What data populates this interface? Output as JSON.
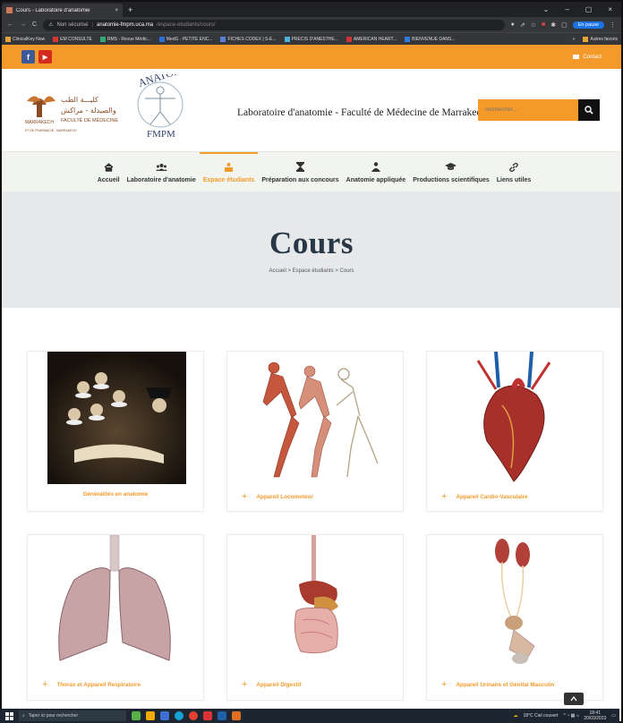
{
  "browser": {
    "tab_title": "Cours - Laboratoire d'anatomie",
    "tab_close": "×",
    "new_tab": "+",
    "window_controls": [
      "⌄",
      "–",
      "▢",
      "×"
    ],
    "security_label": "Non sécurisé",
    "url_domain": "anatomie-fmpm.uca.ma",
    "url_path": "/espace-etudiants/cours/",
    "profile_label": "En pause",
    "bookmarks": [
      "ClinicalKey Now",
      "EM CONSULTE",
      "RMS - Revue Médic...",
      "MedG - PETITE ENC...",
      "FICHES CODEX | S-E...",
      "PRECIS D'ANESTHE...",
      "AMERICAN HEART...",
      "BIENVENUE DANS..."
    ],
    "bookmarks_more": "»",
    "other_favorites": "Autres favoris"
  },
  "topbar": {
    "facebook_label": "f",
    "youtube_label": "▶",
    "contact_label": "Contact"
  },
  "header": {
    "logo_arabic_1": "كليـــة الطب",
    "logo_arabic_2": "والصيدلة - مراكش",
    "logo_fr_1": "FACULTÉ DE MÉDECINE",
    "logo_fr_2": "ET DE PHARMACIE - MARRAKECH",
    "logo_city": "MARRAKECH",
    "logo_anatomie": "ANATOMIE",
    "logo_fmpm": "FMPM",
    "site_title": "Laboratoire d'anatomie - Faculté de Médecine de Marrakech",
    "search_placeholder": "Rechercher..."
  },
  "nav": {
    "items": [
      {
        "label": "Accueil",
        "icon": "home-icon"
      },
      {
        "label": "Laboratoire d'anatomie",
        "icon": "users-icon"
      },
      {
        "label": "Espace étudiants",
        "icon": "student-icon",
        "active": true
      },
      {
        "label": "Préparation aux concours",
        "icon": "hourglass-icon"
      },
      {
        "label": "Anatomie appliquée",
        "icon": "doctor-icon"
      },
      {
        "label": "Productions scientifiques",
        "icon": "graduation-cap-icon"
      },
      {
        "label": "Liens utiles",
        "icon": "link-icon"
      }
    ]
  },
  "hero": {
    "title": "Cours",
    "breadcrumb": "Accueil > Espace étudiants > Cours"
  },
  "courses": [
    {
      "label": "Généralités en anatomie",
      "image": "anatomy-lesson-painting",
      "plus": false
    },
    {
      "label": "Appareil Locomoteur",
      "image": "running-anatomy-figures",
      "plus": true
    },
    {
      "label": "Appareil Cardio-Vasculaire",
      "image": "heart-illustration",
      "plus": true
    },
    {
      "label": "Thorax et Appareil Respiratoire",
      "image": "lungs-illustration",
      "plus": true
    },
    {
      "label": "Appareil Digestif",
      "image": "digestive-system-illustration",
      "plus": true
    },
    {
      "label": "Appareil Urinaire et Génital Masculin",
      "image": "urinary-system-illustration",
      "plus": true
    }
  ],
  "plus_symbol": "+",
  "taskbar": {
    "search_placeholder": "Taper ici pour rechercher",
    "weather": "18°C Ciel couvert",
    "time": "18:41",
    "date": "20/03/2023"
  },
  "colors": {
    "accent": "#f39a2b",
    "hero_bg": "#e6e8ea",
    "title": "#283745"
  }
}
